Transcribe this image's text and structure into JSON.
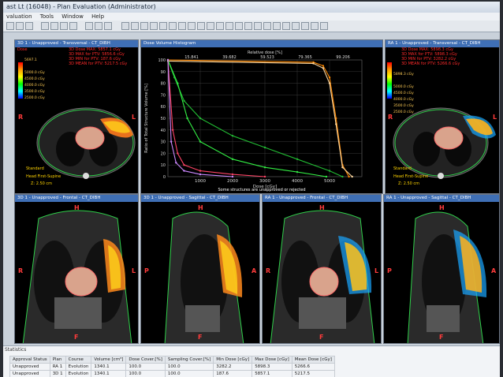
{
  "window": {
    "title": "ast Lt (16048) - Plan Evaluation (Administrator)"
  },
  "menu": [
    "valuation",
    "Tools",
    "Window",
    "Help"
  ],
  "panels": {
    "tl": {
      "header": "3D 1 - Unapproved - Transversal - CT_DIBH",
      "dose_info": "3D Dose MAX: 5857.1 cGy\n3D MAX for PTV: 5856.6 cGy\n3D MIN for PTV: 187.6 cGy\n3D MEAN for PTV: 5217.5 cGy",
      "dose_label": "Dose",
      "dose_max": "5857.1 cGy",
      "legend": "5697.1\n\n5000.0 cGy\n4500.0 cGy\n4000.0 cGy\n3500.0 cGy\n2500.0 cGy",
      "orientation_note": "Standard",
      "position": "Head First-Supine",
      "zoom": "Z: 2.50 cm"
    },
    "tr": {
      "header": "RA 1 - Unapproved - Transversal - CT_DIBH",
      "dose_info": "3D Dose MAX: 5898.3 cGy\n3D MAX for PTV: 5898.3 cGy\n3D MIN for PTV: 3282.2 cGy\n3D MEAN for PTV: 5266.6 cGy",
      "legend": "5898.3 cGy\n\n5000.0 cGy\n4500.0 cGy\n4000.0 cGy\n3500.0 cGy\n2500.0 cGy",
      "orientation_note": "Standard",
      "position": "Head First-Supine",
      "zoom": "Z: 2.50 cm"
    },
    "b1": {
      "header": "3D 1 - Unapproved - Frontal - CT_DIBH"
    },
    "b2": {
      "header": "3D 1 - Unapproved - Sagittal - CT_DIBH"
    },
    "b3": {
      "header": "RA 1 - Unapproved - Frontal - CT_DIBH"
    },
    "b4": {
      "header": "RA 1 - Unapproved - Sagittal - CT_DIBH"
    },
    "letters": {
      "H": "H",
      "F": "F",
      "R": "R",
      "L": "L",
      "A": "A",
      "P": "P"
    }
  },
  "dvh": {
    "header": "Dose Volume Histogram",
    "top_label": "Relative dose [%]",
    "top_ticks": [
      "15.841",
      "39.682",
      "59.523",
      "79.365",
      "99.206"
    ],
    "footer": "Some structures are unapproved or rejected",
    "chart_data": {
      "type": "line",
      "xlabel": "Dose [cGy]",
      "ylabel": "Ratio of Total Structure Volume [%]",
      "xlim": [
        0,
        6000
      ],
      "ylim": [
        0,
        100
      ],
      "x_ticks": [
        1000,
        2000,
        3000,
        4000,
        5000
      ],
      "y_ticks": [
        0,
        10,
        20,
        30,
        40,
        50,
        60,
        70,
        80,
        90,
        100
      ],
      "grid": true,
      "series": [
        {
          "color": "#ff8800",
          "x": [
            0,
            4500,
            4800,
            5000,
            5200,
            5400,
            5600
          ],
          "y": [
            100,
            98,
            95,
            85,
            50,
            10,
            0
          ]
        },
        {
          "color": "#ffd9a0",
          "x": [
            0,
            4500,
            4800,
            5000,
            5200,
            5400,
            5700
          ],
          "y": [
            99,
            97,
            93,
            80,
            45,
            8,
            0
          ]
        },
        {
          "color": "#22bb33",
          "x": [
            0,
            200,
            500,
            1000,
            2000,
            3000,
            4000,
            5000,
            5400
          ],
          "y": [
            100,
            85,
            65,
            50,
            35,
            25,
            15,
            5,
            0
          ]
        },
        {
          "color": "#33ee44",
          "x": [
            0,
            300,
            600,
            1000,
            2000,
            3000,
            4000,
            4900
          ],
          "y": [
            100,
            80,
            50,
            30,
            15,
            8,
            4,
            0
          ]
        },
        {
          "color": "#ff4466",
          "x": [
            0,
            150,
            300,
            500,
            1000,
            2000,
            3000
          ],
          "y": [
            100,
            40,
            20,
            10,
            5,
            2,
            0
          ]
        },
        {
          "color": "#cc88ff",
          "x": [
            0,
            100,
            250,
            500,
            1000,
            2000
          ],
          "y": [
            100,
            30,
            12,
            5,
            2,
            0
          ]
        }
      ]
    }
  },
  "stats": {
    "tab": "Statistics",
    "columns": [
      "Approval Status",
      "Plan",
      "Course",
      "Volume [cm³]",
      "Dose Cover.[%]",
      "Sampling Cover.[%]",
      "Min Dose [cGy]",
      "Max Dose [cGy]",
      "Mean Dose [cGy]"
    ],
    "rows": [
      [
        "Unapproved",
        "RA 1",
        "Evolution",
        "1340.1",
        "100.0",
        "100.0",
        "3282.2",
        "5898.3",
        "5266.6"
      ],
      [
        "Unapproved",
        "3D 1",
        "Evolution",
        "1340.1",
        "100.0",
        "100.0",
        "187.6",
        "5857.1",
        "5217.5"
      ]
    ]
  }
}
